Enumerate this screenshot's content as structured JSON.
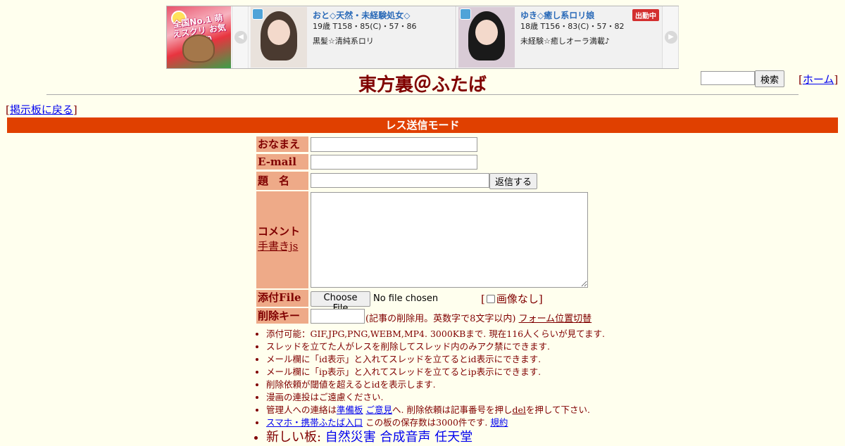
{
  "banner": {
    "logo_text": "全国No.1 萌えスクリ お気に入り",
    "prev_arrow": "◀",
    "next_arrow": "▶",
    "ads": [
      {
        "name": "おと◇天然・未経験処女◇",
        "stats": "19歳 T158・85(C)・57・86",
        "desc": "黒髪☆清純系ロリ",
        "status": "",
        "hair_color": "#4a3a30"
      },
      {
        "name": "ゆき◇癒し系ロリ娘",
        "stats": "18歳 T156・83(C)・57・82",
        "desc": "未経験☆癒しオーラ満載♪",
        "status": "出勤中",
        "hair_color": "#1a1a1a"
      }
    ]
  },
  "header": {
    "title": "東方裏＠ふたば",
    "search_button": "検索",
    "home_open": "[",
    "home_link": "ホーム",
    "home_close": "]"
  },
  "nav": {
    "back_open": "[",
    "back_link": "掲示板に戻る",
    "back_close": "]"
  },
  "mode_label": "レス送信モード",
  "form": {
    "name_label": "おなまえ",
    "email_label": "E-mail",
    "subject_label": "題　名",
    "submit_label": "返信する",
    "comment_label": "コメント",
    "handwrite_link": "手書きjs",
    "file_label": "添付File",
    "file_button": "Choose File",
    "file_status": "No file chosen",
    "noimg_open": "[",
    "noimg_label": "画像なし]",
    "delkey_label": "削除キー",
    "delkey_note": "(記事の削除用。英数字で8文字以内)",
    "form_toggle": "フォーム位置切替"
  },
  "notes": {
    "n1": "添付可能：GIF,JPG,PNG,WEBM,MP4. 3000KBまで. 現在116人くらいが見てます.",
    "n2": "スレッドを立てた人がレスを削除してスレッド内のみアク禁にできます.",
    "n3": "メール欄に「id表示」と入れてスレッドを立てるとid表示にできます.",
    "n4": "メール欄に「ip表示」と入れてスレッドを立てるとip表示にできます.",
    "n5": "削除依頼が閾値を超えるとidを表示します.",
    "n6": "漫画の連投はご遠慮ください.",
    "n7_pre": "管理人への連絡は",
    "n7_link1": "準備板",
    "n7_link2": "ご意見",
    "n7_mid": "へ. 削除依頼は記事番号を押し",
    "n7_link3": "del",
    "n7_post": "を押して下さい.",
    "n8_link": "スマホ・携帯ふたば入口",
    "n8_mid": " この板の保存数は3000件です. ",
    "n8_link2": "規約",
    "n9_pre": "新しい板: ",
    "n9_link1": "自然災害",
    "n9_link2": "合成音声",
    "n9_link3": "任天堂"
  }
}
